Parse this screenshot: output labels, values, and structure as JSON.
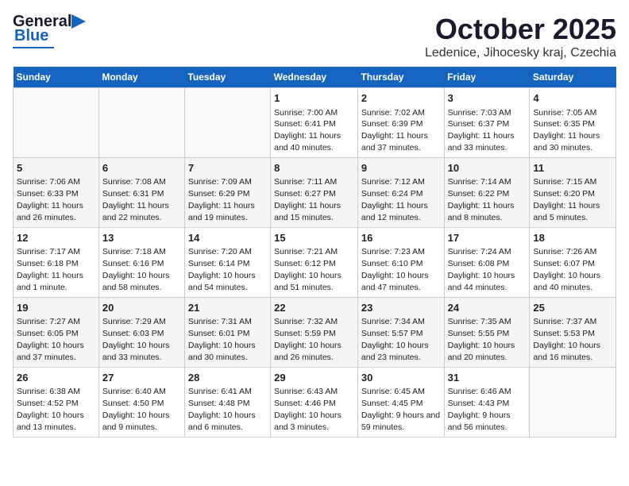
{
  "header": {
    "logo_general": "General",
    "logo_blue": "Blue",
    "title": "October 2025",
    "subtitle": "Ledenice, Jihocesky kraj, Czechia"
  },
  "days_of_week": [
    "Sunday",
    "Monday",
    "Tuesday",
    "Wednesday",
    "Thursday",
    "Friday",
    "Saturday"
  ],
  "weeks": [
    [
      {
        "day": "",
        "info": ""
      },
      {
        "day": "",
        "info": ""
      },
      {
        "day": "",
        "info": ""
      },
      {
        "day": "1",
        "info": "Sunrise: 7:00 AM\nSunset: 6:41 PM\nDaylight: 11 hours and 40 minutes."
      },
      {
        "day": "2",
        "info": "Sunrise: 7:02 AM\nSunset: 6:39 PM\nDaylight: 11 hours and 37 minutes."
      },
      {
        "day": "3",
        "info": "Sunrise: 7:03 AM\nSunset: 6:37 PM\nDaylight: 11 hours and 33 minutes."
      },
      {
        "day": "4",
        "info": "Sunrise: 7:05 AM\nSunset: 6:35 PM\nDaylight: 11 hours and 30 minutes."
      }
    ],
    [
      {
        "day": "5",
        "info": "Sunrise: 7:06 AM\nSunset: 6:33 PM\nDaylight: 11 hours and 26 minutes."
      },
      {
        "day": "6",
        "info": "Sunrise: 7:08 AM\nSunset: 6:31 PM\nDaylight: 11 hours and 22 minutes."
      },
      {
        "day": "7",
        "info": "Sunrise: 7:09 AM\nSunset: 6:29 PM\nDaylight: 11 hours and 19 minutes."
      },
      {
        "day": "8",
        "info": "Sunrise: 7:11 AM\nSunset: 6:27 PM\nDaylight: 11 hours and 15 minutes."
      },
      {
        "day": "9",
        "info": "Sunrise: 7:12 AM\nSunset: 6:24 PM\nDaylight: 11 hours and 12 minutes."
      },
      {
        "day": "10",
        "info": "Sunrise: 7:14 AM\nSunset: 6:22 PM\nDaylight: 11 hours and 8 minutes."
      },
      {
        "day": "11",
        "info": "Sunrise: 7:15 AM\nSunset: 6:20 PM\nDaylight: 11 hours and 5 minutes."
      }
    ],
    [
      {
        "day": "12",
        "info": "Sunrise: 7:17 AM\nSunset: 6:18 PM\nDaylight: 11 hours and 1 minute."
      },
      {
        "day": "13",
        "info": "Sunrise: 7:18 AM\nSunset: 6:16 PM\nDaylight: 10 hours and 58 minutes."
      },
      {
        "day": "14",
        "info": "Sunrise: 7:20 AM\nSunset: 6:14 PM\nDaylight: 10 hours and 54 minutes."
      },
      {
        "day": "15",
        "info": "Sunrise: 7:21 AM\nSunset: 6:12 PM\nDaylight: 10 hours and 51 minutes."
      },
      {
        "day": "16",
        "info": "Sunrise: 7:23 AM\nSunset: 6:10 PM\nDaylight: 10 hours and 47 minutes."
      },
      {
        "day": "17",
        "info": "Sunrise: 7:24 AM\nSunset: 6:08 PM\nDaylight: 10 hours and 44 minutes."
      },
      {
        "day": "18",
        "info": "Sunrise: 7:26 AM\nSunset: 6:07 PM\nDaylight: 10 hours and 40 minutes."
      }
    ],
    [
      {
        "day": "19",
        "info": "Sunrise: 7:27 AM\nSunset: 6:05 PM\nDaylight: 10 hours and 37 minutes."
      },
      {
        "day": "20",
        "info": "Sunrise: 7:29 AM\nSunset: 6:03 PM\nDaylight: 10 hours and 33 minutes."
      },
      {
        "day": "21",
        "info": "Sunrise: 7:31 AM\nSunset: 6:01 PM\nDaylight: 10 hours and 30 minutes."
      },
      {
        "day": "22",
        "info": "Sunrise: 7:32 AM\nSunset: 5:59 PM\nDaylight: 10 hours and 26 minutes."
      },
      {
        "day": "23",
        "info": "Sunrise: 7:34 AM\nSunset: 5:57 PM\nDaylight: 10 hours and 23 minutes."
      },
      {
        "day": "24",
        "info": "Sunrise: 7:35 AM\nSunset: 5:55 PM\nDaylight: 10 hours and 20 minutes."
      },
      {
        "day": "25",
        "info": "Sunrise: 7:37 AM\nSunset: 5:53 PM\nDaylight: 10 hours and 16 minutes."
      }
    ],
    [
      {
        "day": "26",
        "info": "Sunrise: 6:38 AM\nSunset: 4:52 PM\nDaylight: 10 hours and 13 minutes."
      },
      {
        "day": "27",
        "info": "Sunrise: 6:40 AM\nSunset: 4:50 PM\nDaylight: 10 hours and 9 minutes."
      },
      {
        "day": "28",
        "info": "Sunrise: 6:41 AM\nSunset: 4:48 PM\nDaylight: 10 hours and 6 minutes."
      },
      {
        "day": "29",
        "info": "Sunrise: 6:43 AM\nSunset: 4:46 PM\nDaylight: 10 hours and 3 minutes."
      },
      {
        "day": "30",
        "info": "Sunrise: 6:45 AM\nSunset: 4:45 PM\nDaylight: 9 hours and 59 minutes."
      },
      {
        "day": "31",
        "info": "Sunrise: 6:46 AM\nSunset: 4:43 PM\nDaylight: 9 hours and 56 minutes."
      },
      {
        "day": "",
        "info": ""
      }
    ]
  ]
}
